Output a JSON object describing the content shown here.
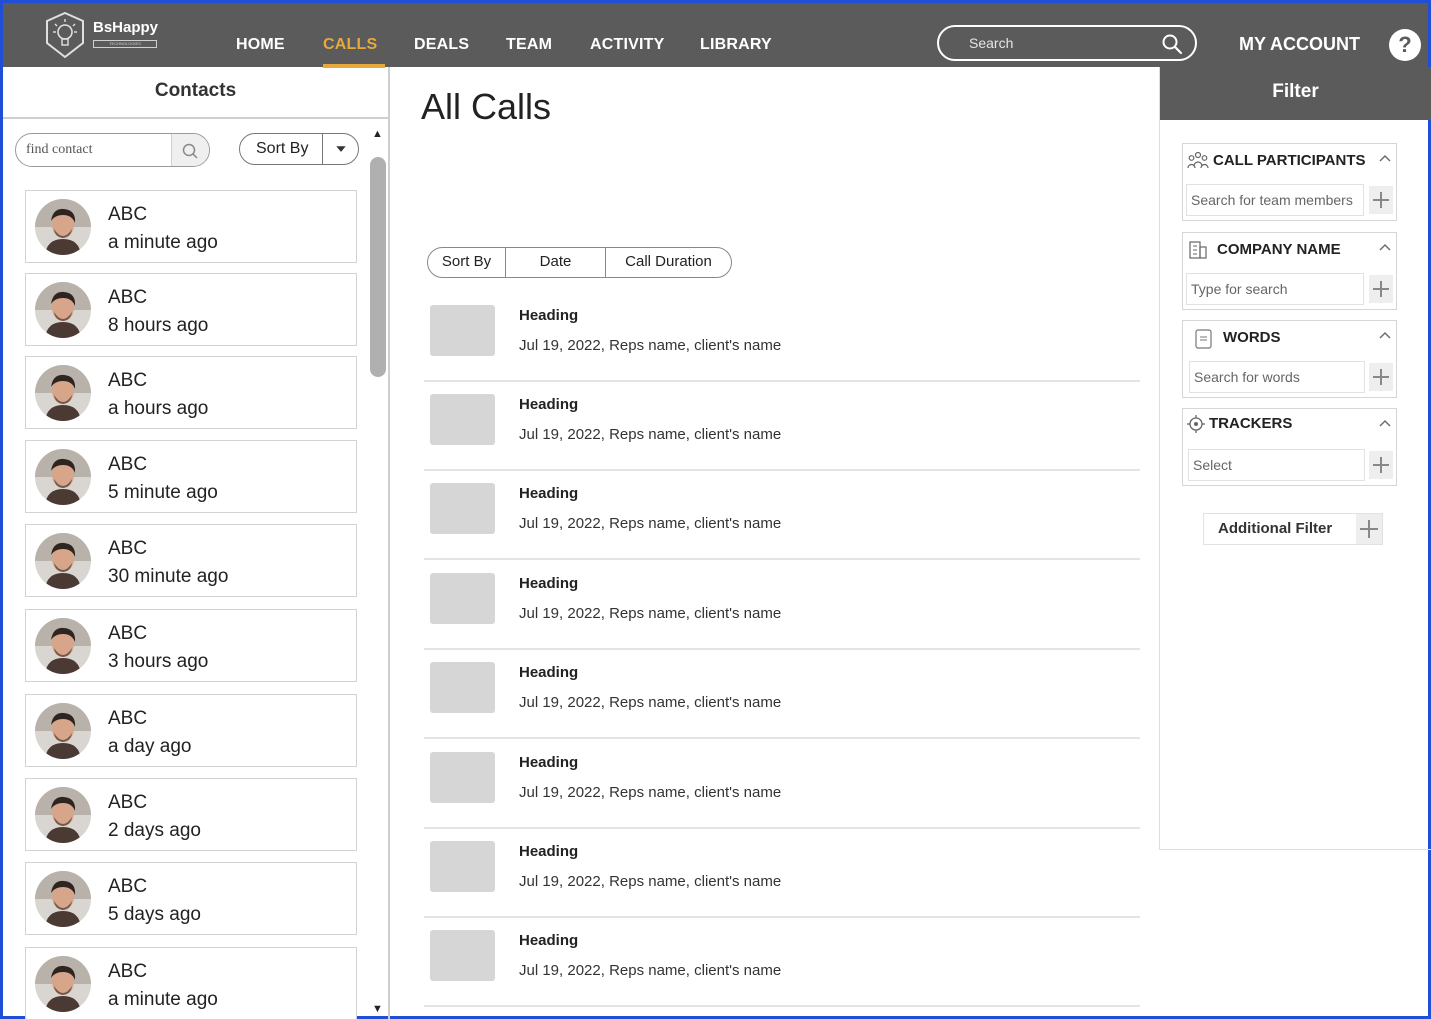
{
  "app": {
    "logo_name": "BsHappy",
    "logo_sub": "TECHNOLOGIES"
  },
  "nav": {
    "items": [
      "HOME",
      "CALLS",
      "DEALS",
      "TEAM",
      "ACTIVITY",
      "LIBRARY"
    ],
    "active": "CALLS",
    "search_placeholder": "Search",
    "my_account": "MY ACCOUNT",
    "help": "?"
  },
  "colors": {
    "nav_bg": "#5b5b5b",
    "accent": "#e6a93a",
    "frame": "#1f4fd6"
  },
  "contacts": {
    "title": "Contacts",
    "find_placeholder": "find contact",
    "sort_label": "Sort By",
    "items": [
      {
        "name": "ABC",
        "time": "a minute ago"
      },
      {
        "name": "ABC",
        "time": "8 hours ago"
      },
      {
        "name": "ABC",
        "time": "a hours ago"
      },
      {
        "name": "ABC",
        "time": "5 minute ago"
      },
      {
        "name": "ABC",
        "time": "30 minute ago"
      },
      {
        "name": "ABC",
        "time": "3 hours ago"
      },
      {
        "name": "ABC",
        "time": "a day ago"
      },
      {
        "name": "ABC",
        "time": "2 days ago"
      },
      {
        "name": "ABC",
        "time": "5 days ago"
      },
      {
        "name": "ABC",
        "time": "a minute ago"
      }
    ]
  },
  "main": {
    "title": "All Calls",
    "sort": {
      "label": "Sort By",
      "options": [
        "Date",
        "Call Duration"
      ]
    },
    "calls": [
      {
        "heading": "Heading",
        "meta": "Jul 19, 2022,  Reps name, client's name"
      },
      {
        "heading": "Heading",
        "meta": "Jul 19, 2022,  Reps name, client's name"
      },
      {
        "heading": "Heading",
        "meta": "Jul 19, 2022,  Reps name, client's name"
      },
      {
        "heading": "Heading",
        "meta": "Jul 19, 2022,  Reps name, client's name"
      },
      {
        "heading": "Heading",
        "meta": "Jul 19, 2022,  Reps name, client's name"
      },
      {
        "heading": "Heading",
        "meta": "Jul 19, 2022,  Reps name, client's name"
      },
      {
        "heading": "Heading",
        "meta": "Jul 19, 2022,  Reps name, client's name"
      },
      {
        "heading": "Heading",
        "meta": "Jul 19, 2022,  Reps name, client's name"
      }
    ]
  },
  "filter": {
    "title": "Filter",
    "sections": [
      {
        "title": "CALL PARTICIPANTS",
        "placeholder": "Search for team members",
        "icon": "people-icon"
      },
      {
        "title": "COMPANY NAME",
        "placeholder": "Type for search",
        "icon": "building-icon"
      },
      {
        "title": "WORDS",
        "placeholder": "Search for words",
        "icon": "document-icon"
      },
      {
        "title": "TRACKERS",
        "placeholder": "Select",
        "icon": "target-icon"
      }
    ],
    "additional": "Additional Filter"
  }
}
